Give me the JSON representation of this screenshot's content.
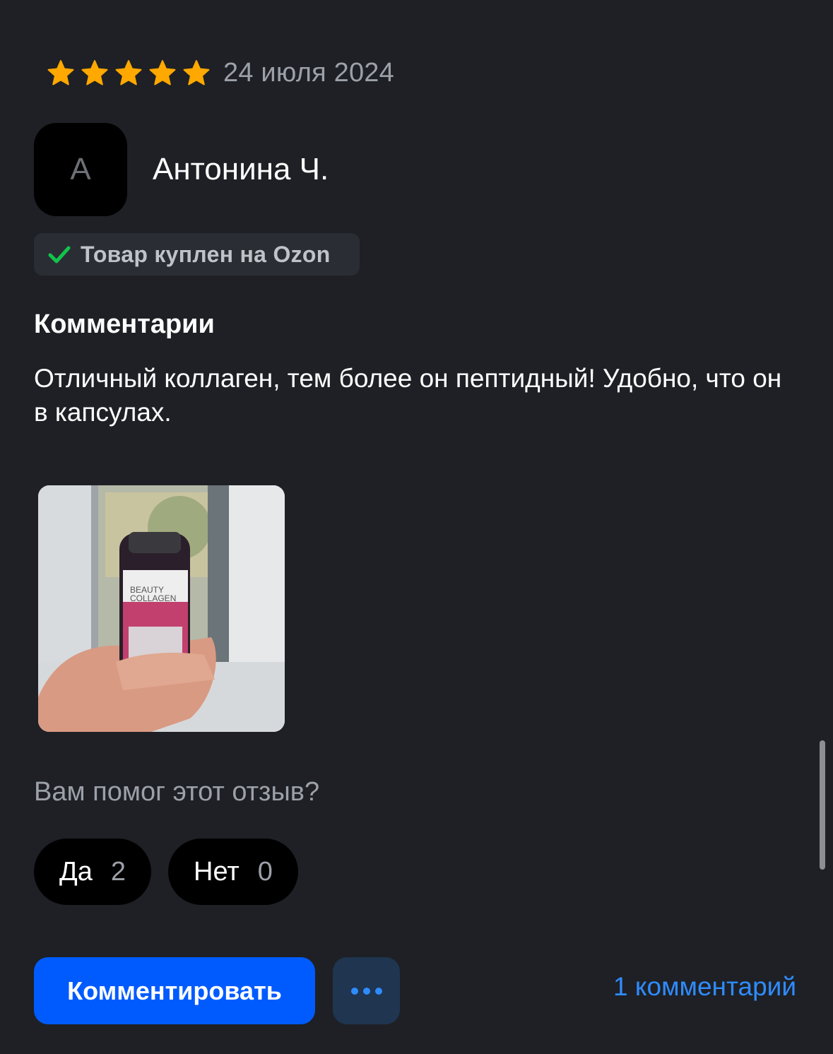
{
  "review": {
    "rating": 5,
    "rating_max": 5,
    "star_color": "#ffa800",
    "date": "24 июля 2024",
    "author": {
      "initial": "А",
      "name": "Антонина Ч."
    },
    "verified_badge": {
      "icon": "check-icon",
      "text": "Товар куплен на Ozon"
    },
    "section_title": "Комментарии",
    "text": "Отличный коллаген, тем более он пептидный! Удобно, что он в капсулах.",
    "photo": {
      "icon": "review-photo",
      "label_line1": "BEAUTY",
      "label_line2": "COLLAGEN"
    }
  },
  "helpful": {
    "question": "Вам помог этот отзыв?",
    "yes_label": "Да",
    "yes_count": "2",
    "no_label": "Нет",
    "no_count": "0"
  },
  "actions": {
    "comment_button": "Комментировать",
    "more_icon": "ellipsis-icon",
    "comments_link": "1 комментарий",
    "primary_color": "#005bff",
    "link_color": "#2f8cff"
  }
}
